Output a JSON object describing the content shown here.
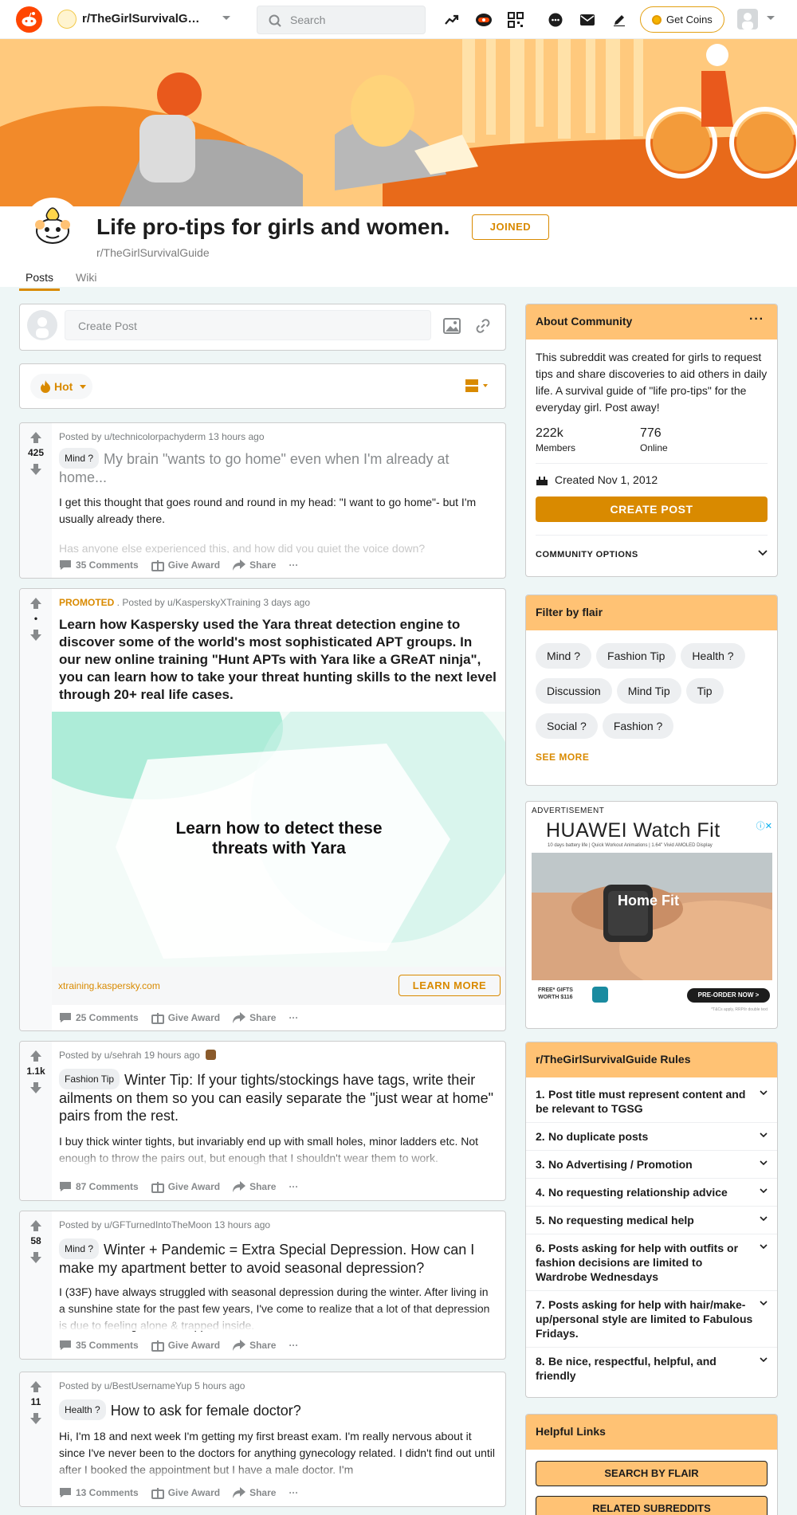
{
  "header": {
    "subreddit": "r/TheGirlSurvivalGuide",
    "search_placeholder": "Search",
    "get_coins": "Get Coins"
  },
  "community": {
    "title": "Life pro-tips for girls and women.",
    "name": "r/TheGirlSurvivalGuide",
    "joined_label": "JOINED",
    "tabs": [
      "Posts",
      "Wiki"
    ]
  },
  "create_post": {
    "placeholder": "Create Post"
  },
  "sort": {
    "label": "Hot"
  },
  "posts": [
    {
      "votes": "425",
      "meta": "Posted by u/technicolorpachyderm 13 hours ago",
      "flair": "Mind ?",
      "title": "My brain \"wants to go home\" even when I'm already at home...",
      "body": "I get this thought that goes round and round in my head: \"I want to go home\"- but I'm usually already there.",
      "body2": "Has anyone else experienced this, and how did you quiet the voice down?",
      "comments": "35 Comments"
    },
    {
      "votes": "•",
      "promoted": "PROMOTED",
      "meta": " . Posted by u/KasperskyXTraining 3 days ago",
      "title": "Learn how Kaspersky used the Yara threat detection engine to discover some of the world's most sophisticated APT groups. In our new online training \"Hunt APTs with Yara like a GReAT ninja\", you can learn how to take your threat hunting skills to the next level through 20+ real life cases.",
      "ad_text": "Learn how to detect these threats with Yara",
      "link": "xtraining.kaspersky.com",
      "learn_more": "LEARN MORE",
      "comments": "25 Comments"
    },
    {
      "votes": "1.1k",
      "meta": "Posted by u/sehrah 19 hours ago",
      "flair": "Fashion Tip",
      "title": "Winter Tip: If your tights/stockings have tags, write their ailments on them so you can easily separate the \"just wear at home\" pairs from the rest.",
      "body": "I buy thick winter tights, but invariably end up with small holes, minor ladders etc. Not enough to throw the pairs out, but enough that I shouldn't wear them to work.",
      "comments": "87 Comments"
    },
    {
      "votes": "58",
      "meta": "Posted by u/GFTurnedIntoTheMoon 13 hours ago",
      "flair": "Mind ?",
      "title": "Winter + Pandemic = Extra Special Depression. How can I make my apartment better to avoid seasonal depression?",
      "body": "I (33F) have always struggled with seasonal depression during the winter. After living in a sunshine state for the past few years, I've come to realize that a lot of that depression is due to feeling alone & trapped inside.",
      "comments": "35 Comments"
    },
    {
      "votes": "11",
      "meta": "Posted by u/BestUsernameYup 5 hours ago",
      "flair": "Health ?",
      "title": "How to ask for female doctor?",
      "body": "Hi, I'm 18 and next week I'm getting my first breast exam. I'm really nervous about it since I've never been to the doctors for anything gynecology related. I didn't find out until after I booked the appointment but I have a male doctor. I'm",
      "comments": "13 Comments"
    }
  ],
  "actions": {
    "give_award": "Give Award",
    "share": "Share",
    "more": "···"
  },
  "about": {
    "heading": "About Community",
    "description": "This subreddit was created for girls to request tips and share discoveries to aid others in daily life. A survival guide of \"life pro-tips\" for the everyday girl. Post away!",
    "members_value": "222k",
    "members_label": "Members",
    "online_value": "776",
    "online_label": "Online",
    "created": "Created Nov 1, 2012",
    "create_post": "CREATE POST",
    "options": "COMMUNITY OPTIONS"
  },
  "flair_filter": {
    "heading": "Filter by flair",
    "flairs": [
      "Mind ?",
      "Fashion Tip",
      "Health ?",
      "Discussion",
      "Mind Tip",
      "Tip",
      "Social ?",
      "Fashion ?"
    ],
    "see_more": "SEE MORE"
  },
  "advert": {
    "label": "ADVERTISEMENT",
    "brand": "HUAWEI Watch Fit",
    "tagline": "10 days battery life | Quick Workout Animations | 1.64\" Vivid AMOLED Display",
    "overlay": "Home Fit",
    "gifts": "FREE* GIFTS WORTH $116",
    "preorder": "PRE-ORDER NOW >",
    "fine": "*T&Cs apply, RRP/ir double text"
  },
  "rules": {
    "heading": "r/TheGirlSurvivalGuide Rules",
    "items": [
      "Post title must represent content and be relevant to TGSG",
      "No duplicate posts",
      "No Advertising / Promotion",
      "No requesting relationship advice",
      "No requesting medical help",
      "Posts asking for help with outfits or fashion decisions are limited to Wardrobe Wednesdays",
      "Posts asking for help with hair/make-up/personal style are limited to Fabulous Fridays.",
      "Be nice, respectful, helpful, and friendly"
    ]
  },
  "helpful_links": {
    "heading": "Helpful Links",
    "buttons": [
      "SEARCH BY FLAIR",
      "RELATED SUBREDDITS"
    ]
  },
  "colors": {
    "accent": "#d98a00",
    "header_bar": "#ffc274",
    "reddit": "#ff4500",
    "bg": "#eef6f6"
  }
}
